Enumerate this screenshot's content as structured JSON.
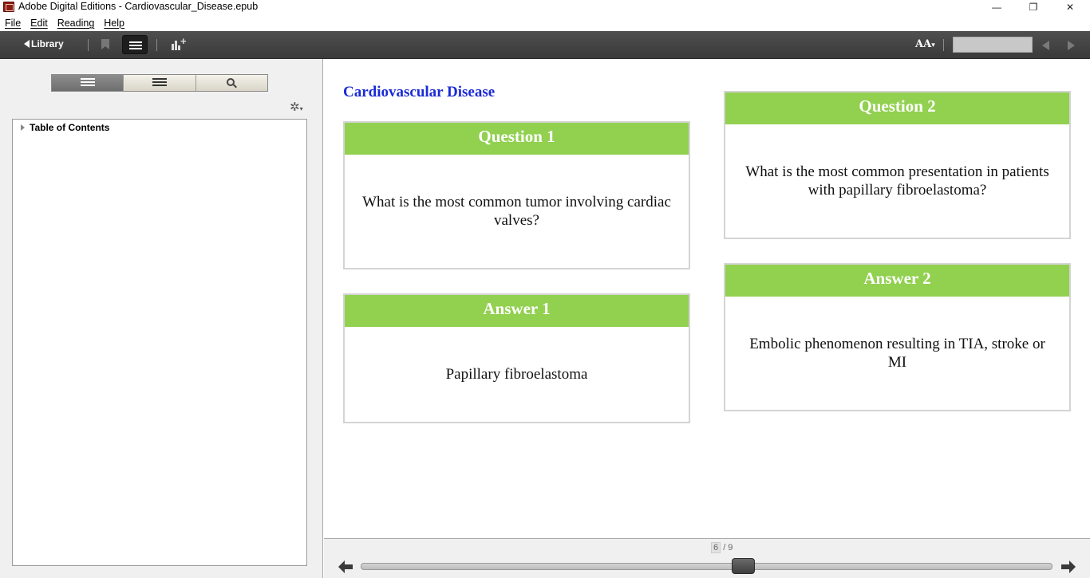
{
  "window": {
    "title": "Adobe Digital Editions - Cardiovascular_Disease.epub",
    "minimize_glyph": "—",
    "maximize_glyph": "❐",
    "close_glyph": "✕"
  },
  "menu": {
    "items": [
      "File",
      "Edit",
      "Reading",
      "Help"
    ]
  },
  "toolbar": {
    "library_label": "Library",
    "font_label": "AA",
    "font_dropdown_glyph": "▾",
    "page_value": ""
  },
  "sidebar": {
    "tabs": [
      {
        "icon": "thumbnail-list-icon",
        "active": true
      },
      {
        "icon": "bookmark-list-icon",
        "active": false
      },
      {
        "icon": "search-icon",
        "active": false
      }
    ],
    "gear_glyph": "✲",
    "toc_label": "Table of Contents"
  },
  "book": {
    "title": "Cardiovascular Disease",
    "cards": [
      {
        "heading": "Question 1",
        "body": "What is the most common tumor involving cardiac valves?"
      },
      {
        "heading": "Answer 1",
        "body": "Papillary fibroelastoma"
      },
      {
        "heading": "Question 2",
        "body": "What is the most common presentation in patients with papillary fibroelastoma?"
      },
      {
        "heading": "Answer 2",
        "body": "Embolic phenomenon resulting in TIA, stroke or MI"
      }
    ]
  },
  "pager": {
    "current": "6",
    "total": "/ 9",
    "progress_fraction": 0.55
  },
  "colors": {
    "card_header": "#92d050",
    "title_blue": "#1a2ad6",
    "toolbar_dark": "#444444"
  }
}
